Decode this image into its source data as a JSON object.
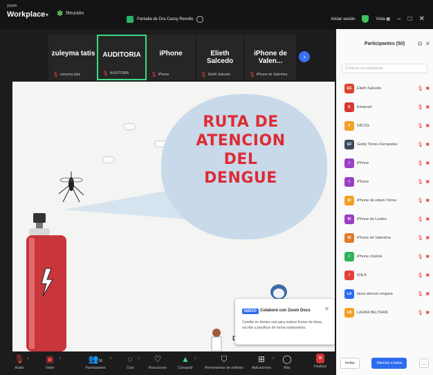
{
  "window": {
    "brand_small": "zoom",
    "brand_big": "Workplace",
    "meeting_label": "Reunión",
    "share_label": "Pantalla de Dra Cassy Revollo",
    "signin_label": "Iniciar sesión",
    "view_label": "Vista"
  },
  "thumbnails": [
    {
      "name": "zuleyma tatis",
      "tag": "zuleyma tatis"
    },
    {
      "name": "AUDITORIA",
      "tag": "AUDITORIA"
    },
    {
      "name": "iPhone",
      "tag": "iPhone"
    },
    {
      "name": "Elieth Salcedo",
      "tag": "Elieth Salcedo"
    },
    {
      "name": "iPhone de Valen...",
      "tag": "iPhone de Valentina"
    }
  ],
  "slide": {
    "title_lines": [
      "RUTA DE",
      "ATENCION",
      "DEL",
      "DENGUE"
    ],
    "bottom_text": "Dr"
  },
  "notification": {
    "badge": "NUEVO",
    "title": "Colabore con Zoom Docs",
    "body": "Coedite en tiempo real para realizar lluvias de ideas, escribir y planificar de forma colaborativa."
  },
  "panel": {
    "title": "Participantes (50)",
    "search_placeholder": "Q Buscar un participante",
    "participants": [
      {
        "initials": "ES",
        "name": "Elieth Salcedo",
        "color": "#d9472b"
      },
      {
        "initials": "E",
        "name": "Emanuel",
        "color": "#d6392f"
      },
      {
        "initials": "F",
        "name": "FACSS",
        "color": "#f2a026"
      },
      {
        "initials": "GF",
        "name": "Geidy Torres Fernandez",
        "color": "#3b4a5c"
      },
      {
        "initials": "I",
        "name": "iPhone",
        "color": "#9b3fc6"
      },
      {
        "initials": "I",
        "name": "iPhone",
        "color": "#9b3fc6"
      },
      {
        "initials": "ID",
        "name": "iPhone de edwin Torres",
        "color": "#f2a026"
      },
      {
        "initials": "ID",
        "name": "iPhone de Lurdes",
        "color": "#9b3fc6"
      },
      {
        "initials": "ID",
        "name": "iPhone de Valentina",
        "color": "#e27a2a"
      },
      {
        "initials": "I",
        "name": "iPhone charlok",
        "color": "#2fb35a"
      },
      {
        "initials": "I",
        "name": "IDILA",
        "color": "#e2423b"
      },
      {
        "initials": "LA",
        "name": "laura atencio vergara",
        "color": "#2d6cf0"
      },
      {
        "initials": "LB",
        "name": "LAURA BELTRAN",
        "color": "#f2a026"
      }
    ],
    "invite_label": "Invitar",
    "mute_all_label": "Silenciar a todos",
    "more_label": "..."
  },
  "toolbar": {
    "audio": "Audio",
    "video": "Video",
    "participants": "Participantes",
    "participants_count": "50",
    "chat": "Chat",
    "reactions": "Reacciones",
    "share": "Compartir",
    "tools": "Herramientas de anfitrión",
    "apps": "Aplicaciones",
    "more": "Más",
    "end": "Finalizar"
  },
  "colors": {
    "accent_green": "#3ddc84",
    "accent_blue": "#2d6cf0",
    "mute_red": "#e2423b",
    "slide_title": "#de2b33"
  }
}
